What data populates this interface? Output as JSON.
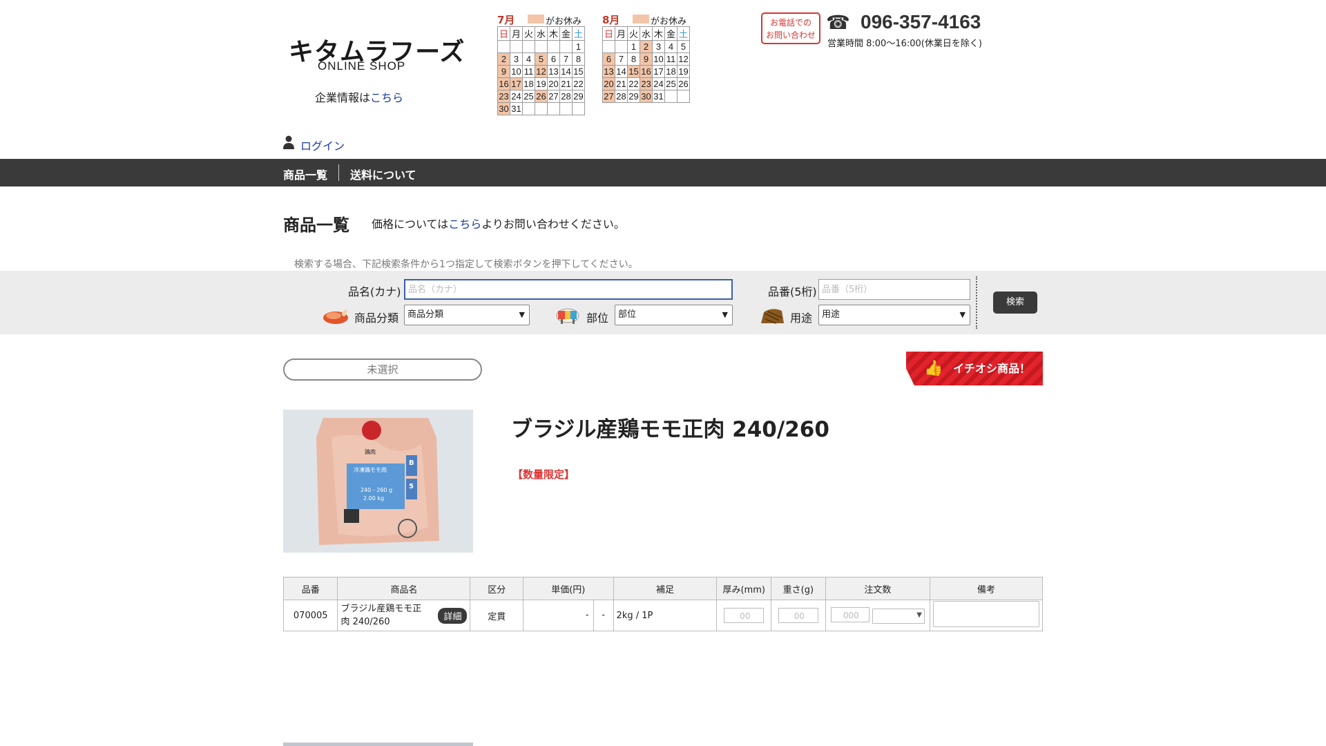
{
  "header": {
    "logo_main": "キタムラフーズ",
    "logo_sub": "ONLINE SHOP",
    "corp_prefix": "企業情報は",
    "corp_link": "こちら",
    "login": "ログイン"
  },
  "calendars": [
    {
      "month": "7月",
      "holiday_note": "がお休み",
      "weekdays": [
        "日",
        "月",
        "火",
        "水",
        "木",
        "金",
        "土"
      ],
      "weeks": [
        [
          "",
          "",
          "",
          "",
          "",
          "",
          "1"
        ],
        [
          "2",
          "3",
          "4",
          "5",
          "6",
          "7",
          "8"
        ],
        [
          "9",
          "10",
          "11",
          "12",
          "13",
          "14",
          "15"
        ],
        [
          "16",
          "17",
          "18",
          "19",
          "20",
          "21",
          "22"
        ],
        [
          "23",
          "24",
          "25",
          "26",
          "27",
          "28",
          "29"
        ],
        [
          "30",
          "31",
          "",
          "",
          "",
          "",
          ""
        ]
      ],
      "off_days": [
        "2",
        "5",
        "9",
        "12",
        "16",
        "17",
        "23",
        "26",
        "30"
      ]
    },
    {
      "month": "8月",
      "holiday_note": "がお休み",
      "weekdays": [
        "日",
        "月",
        "火",
        "水",
        "木",
        "金",
        "土"
      ],
      "weeks": [
        [
          "",
          "",
          "1",
          "2",
          "3",
          "4",
          "5"
        ],
        [
          "6",
          "7",
          "8",
          "9",
          "10",
          "11",
          "12"
        ],
        [
          "13",
          "14",
          "15",
          "16",
          "17",
          "18",
          "19"
        ],
        [
          "20",
          "21",
          "22",
          "23",
          "24",
          "25",
          "26"
        ],
        [
          "27",
          "28",
          "29",
          "30",
          "31",
          "",
          ""
        ]
      ],
      "off_days": [
        "2",
        "6",
        "9",
        "13",
        "15",
        "16",
        "20",
        "23",
        "27",
        "30"
      ]
    }
  ],
  "contact": {
    "button_line1": "お電話での",
    "button_line2": "お問い合わせ",
    "phone": "096-357-4163",
    "hours": "営業時間 8:00〜16:00(休業日を除く)"
  },
  "nav": {
    "items": [
      "商品一覧",
      "送料について"
    ]
  },
  "main": {
    "heading": "商品一覧",
    "price_note_pre": "価格については",
    "price_note_link": "こちら",
    "price_note_post": "よりお問い合わせください。",
    "search_hint": "検索する場合、下記検索条件から1つ指定して検索ボタンを押下してください。"
  },
  "search": {
    "name_label": "品名(カナ)",
    "name_placeholder": "品名（カナ）",
    "code_label": "品番(5桁)",
    "code_placeholder": "品番（5桁）",
    "category_label": "商品分類",
    "category_value": "商品分類",
    "part_label": "部位",
    "part_value": "部位",
    "use_label": "用途",
    "use_value": "用途",
    "button": "検索"
  },
  "filter_pill": "未選択",
  "banner": "イチオシ商品！",
  "product": {
    "title": "ブラジル産鶏モモ正肉 240/260",
    "badge": "【数量限定】",
    "image_text": [
      "鶏肉",
      "冷凍鶏モモ肉",
      "240 - 260 g",
      "2.00 kg",
      "B",
      "5"
    ]
  },
  "table": {
    "headers": [
      "品番",
      "商品名",
      "区分",
      "単価(円)",
      "補足",
      "厚み(mm)",
      "重さ(g)",
      "注文数",
      "備考"
    ],
    "row": {
      "code": "070005",
      "name": "ブラジル産鶏モモ正肉 240/260",
      "detail_button": "詳細",
      "category": "定貫",
      "price": "-",
      "price2": "-",
      "note": "2kg / 1P",
      "thickness_placeholder": "00",
      "weight_placeholder": "00",
      "qty_placeholder": "000"
    }
  },
  "colors": {
    "accent_red": "#d33",
    "nav_bg": "#3a3a3a",
    "holiday": "#f3c5a8",
    "banner_red": "#e1232b"
  }
}
